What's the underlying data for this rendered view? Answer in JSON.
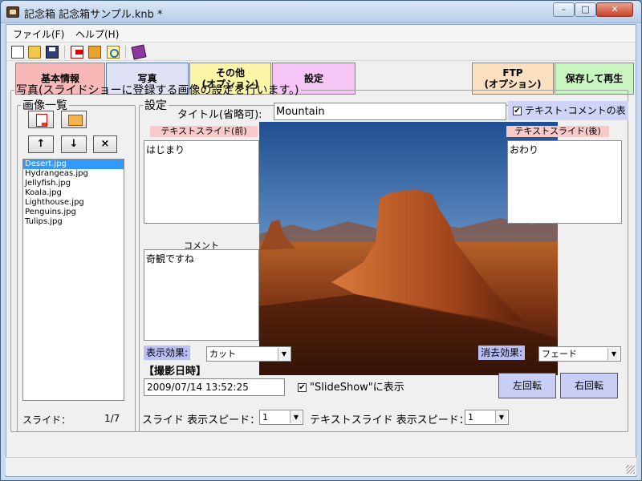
{
  "window": {
    "title": "記念箱 記念箱サンプル.knb *",
    "min_symbol": "–",
    "max_symbol": "□",
    "close_symbol": "✕"
  },
  "menu": {
    "file": "ファイル(F)",
    "help": "ヘルプ(H)"
  },
  "toolbar": {
    "icons": [
      "new-file-icon",
      "open-folder-icon",
      "save-disk-icon",
      "import-icon",
      "open-project-icon",
      "search-image-icon",
      "book-icon"
    ]
  },
  "tabs": {
    "basic": "基本情報",
    "photo": "写真",
    "other": "その他\n(オプション)",
    "settings": "設定",
    "ftp": "FTP\n(オプション)",
    "save_play": "保存して再生"
  },
  "photo_section": {
    "legend": "写真(スライドショーに登録する画像の設定を行います。)"
  },
  "image_list": {
    "legend": "画像一覧",
    "up_symbol": "↑",
    "down_symbol": "↓",
    "delete_symbol": "×",
    "items": [
      "Desert.jpg",
      "Hydrangeas.jpg",
      "Jellyfish.jpg",
      "Koala.jpg",
      "Lighthouse.jpg",
      "Penguins.jpg",
      "Tulips.jpg"
    ],
    "selected_index": 0,
    "slide_label": "スライド：",
    "slide_count": "1/7"
  },
  "settings": {
    "legend": "設定",
    "title_label": "タイトル(省略可):",
    "title_value": "Mountain",
    "show_text_comment": "テキスト･コメントの表示",
    "show_text_comment_checked": true,
    "text_slide_before_label": "テキストスライド(前)",
    "text_slide_before_value": "はじまり",
    "text_slide_after_label": "テキストスライド(後)",
    "text_slide_after_value": "おわり",
    "comment_label": "コメント",
    "comment_value": "奇観ですね",
    "display_effect_label": "表示効果:",
    "display_effect_value": "カット",
    "remove_effect_label": "消去効果:",
    "remove_effect_value": "フェード",
    "shoot_date_label": "【撮影日時】",
    "shoot_date_value": "2009/07/14 13:52:25",
    "show_in_slideshow": "\"SlideShow\"に表示",
    "show_in_slideshow_checked": true,
    "rotate_left": "左回転",
    "rotate_right": "右回転",
    "slide_speed_label": "スライド 表示スピード：",
    "slide_speed_value": "1",
    "text_slide_speed_label": "テキストスライド 表示スピード：",
    "text_slide_speed_value": "1"
  },
  "colors": {
    "tab_basic": "#f9b8b8",
    "tab_photo": "#dfe2f5",
    "tab_other": "#fdf6a8",
    "tab_settings": "#f5c6f5",
    "tab_ftp": "#fbe0c0",
    "tab_save_play": "#c9f5c0",
    "selection": "#3399ff",
    "label_blue": "#b9bff5"
  }
}
